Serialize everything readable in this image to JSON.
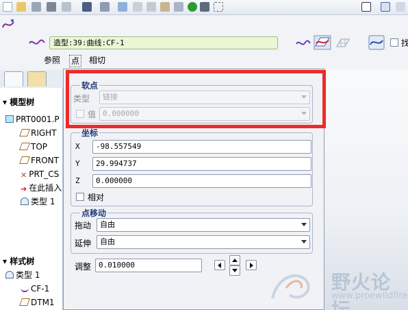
{
  "dashboard": {
    "curve_value": "造型:39:曲线:CF-1",
    "tabs": [
      "参照",
      "点",
      "相切"
    ],
    "partial_label": "找"
  },
  "left_panel": {
    "model_tree": {
      "title": "模型树",
      "items": [
        "PRT0001.P",
        "RIGHT",
        "TOP",
        "FRONT",
        "PRT_CS",
        "在此插入",
        "类型 1"
      ]
    },
    "style_tree": {
      "title": "样式树",
      "items": [
        "类型 1",
        "CF-1",
        "DTM1"
      ]
    }
  },
  "dialog": {
    "soft_point": {
      "title": "软点",
      "type_label": "类型",
      "type_value": "链接",
      "value_label": "值",
      "value_value": "0.000000"
    },
    "coordinates": {
      "title": "坐标",
      "x_label": "X",
      "x_value": "-98.557549",
      "y_label": "Y",
      "y_value": "29.994737",
      "z_label": "Z",
      "z_value": "0.000000",
      "relative_label": "相对"
    },
    "point_move": {
      "title": "点移动",
      "drag_label": "拖动",
      "drag_value": "自由",
      "extend_label": "延伸",
      "extend_value": "自由"
    },
    "adjust": {
      "label": "调整",
      "value": "0.010000"
    }
  },
  "watermark": {
    "text": "野火论坛",
    "url": "www.proewildfire.cn"
  },
  "colors": {
    "highlight_box": "#ee2a2a",
    "group_title": "#1f3a7a",
    "curve_field_bg": "#e9f7d4"
  }
}
